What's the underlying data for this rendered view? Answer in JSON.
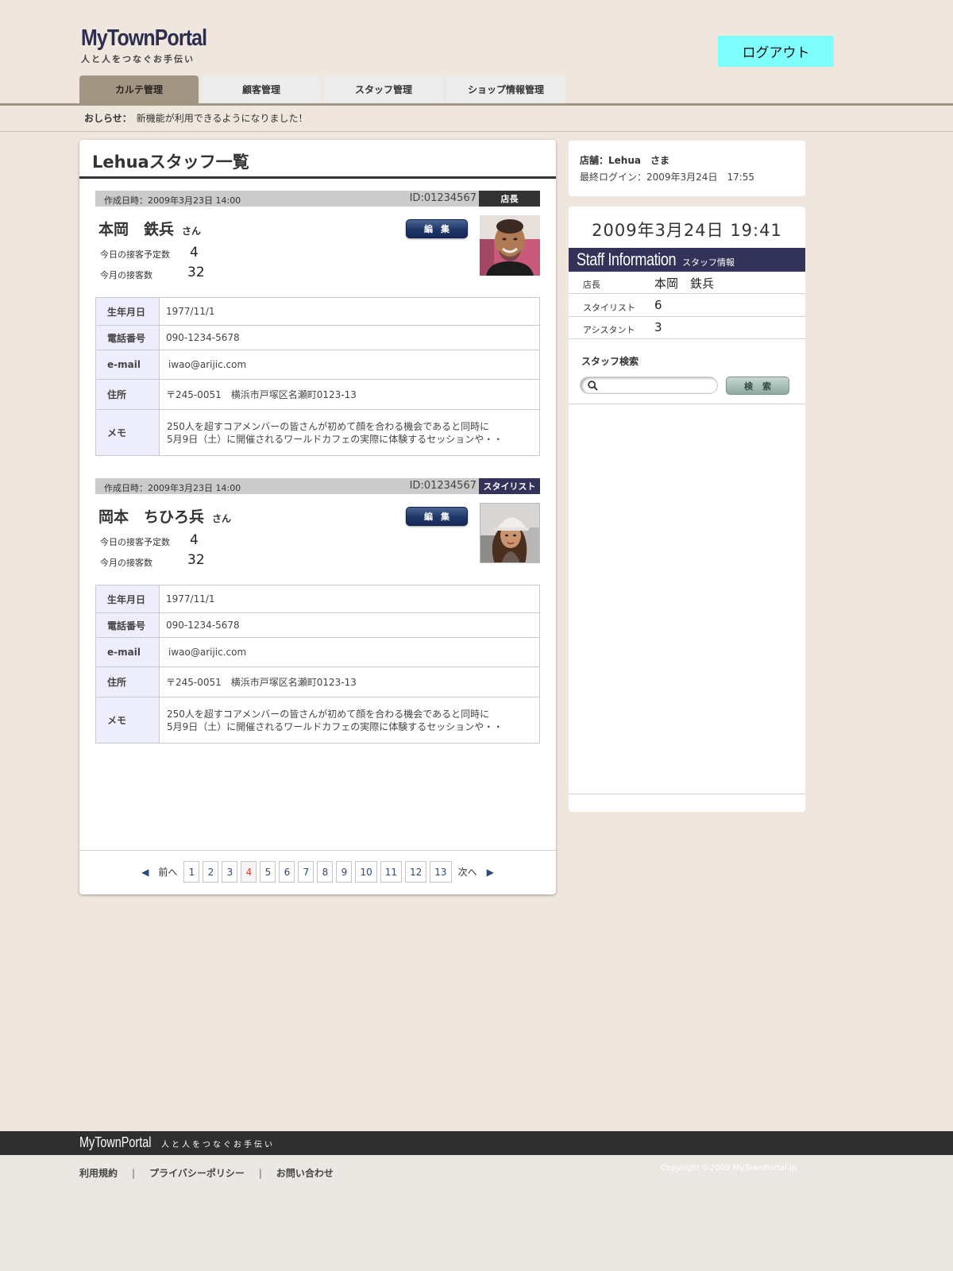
{
  "header": {
    "logo_title": "MyTownPortal",
    "logo_subtitle": "人と人をつなぐお手伝い",
    "logout_label": "ログアウト"
  },
  "nav": {
    "tabs": [
      {
        "label": "カルテ管理",
        "active": true
      },
      {
        "label": "顧客管理",
        "active": false
      },
      {
        "label": "スタッフ管理",
        "active": false
      },
      {
        "label": "ショップ情報管理",
        "active": false
      }
    ]
  },
  "notice": {
    "label": "おしらせ：",
    "text": "新機能が利用できるようになりました！"
  },
  "main": {
    "title": "Lehuaスタッフ一覧",
    "staff": [
      {
        "created": "作成日時：2009年3月23日 14:00",
        "id": "ID:01234567",
        "role": "店長",
        "role_color": "#333333",
        "name": "本岡　鉄兵",
        "suffix": "さん",
        "edit_label": "編集",
        "today_label": "今日の接客予定数",
        "today_value": "4",
        "month_label": "今月の接客数",
        "month_value": "32",
        "photo": "staff-photo-male",
        "details": {
          "birthday_label": "生年月日",
          "birthday": "1977/11/1",
          "phone_label": "電話番号",
          "phone": "090-1234-5678",
          "email_label": "e-mail",
          "email": "iwao@arijic.com",
          "address_label": "住所",
          "address": "〒245-0051　横浜市戸塚区名瀬町0123-13",
          "memo_label": "メモ",
          "memo_line1": "250人を超すコアメンバーの皆さんが初めて顔を合わる機会であると同時に",
          "memo_line2": "5月9日（土）に開催されるワールドカフェの実際に体験するセッションや・・"
        }
      },
      {
        "created": "作成日時：2009年3月23日 14:00",
        "id": "ID:01234567",
        "role": "スタイリスト",
        "role_color": "#33335a",
        "name": "岡本　ちひろ兵",
        "suffix": "さん",
        "edit_label": "編集",
        "today_label": "今日の接客予定数",
        "today_value": "4",
        "month_label": "今月の接客数",
        "month_value": "32",
        "photo": "staff-photo-female",
        "details": {
          "birthday_label": "生年月日",
          "birthday": "1977/11/1",
          "phone_label": "電話番号",
          "phone": "090-1234-5678",
          "email_label": "e-mail",
          "email": "iwao@arijic.com",
          "address_label": "住所",
          "address": "〒245-0051　横浜市戸塚区名瀬町0123-13",
          "memo_label": "メモ",
          "memo_line1": "250人を超すコアメンバーの皆さんが初めて顔を合わる機会であると同時に",
          "memo_line2": "5月9日（土）に開催されるワールドカフェの実際に体験するセッションや・・"
        }
      }
    ],
    "pagination": {
      "prev_arrow": "◀",
      "prev_label": "前へ",
      "pages": [
        "1",
        "2",
        "3",
        "4",
        "5",
        "6",
        "7",
        "8",
        "9",
        "10",
        "11",
        "12",
        "13"
      ],
      "current": "4",
      "next_label": "次へ",
      "next_arrow": "▶"
    }
  },
  "sidebar": {
    "shop": "店舗：Lehua　さま",
    "last_login": "最終ログイン：2009年3月24日　17:55",
    "clock": "2009年3月24日 19:41",
    "staff_info_title": "Staff Information",
    "staff_info_subtitle": "スタッフ情報",
    "rows": [
      {
        "label": "店長",
        "value": "本岡　鉄兵"
      },
      {
        "label": "スタイリスト",
        "value": "6"
      },
      {
        "label": "アシスタント",
        "value": "3"
      }
    ],
    "search_title": "スタッフ検索",
    "search_value": "",
    "search_button": "検索"
  },
  "footer": {
    "logo": "MyTownPortal",
    "tagline": "人と人をつなぐお手伝い",
    "links": [
      "利用規約",
      "プライバシーポリシー",
      "お問い合わせ"
    ],
    "separator": "|",
    "copyright": "Copyright ©2009 MyTownPortal.jp"
  }
}
